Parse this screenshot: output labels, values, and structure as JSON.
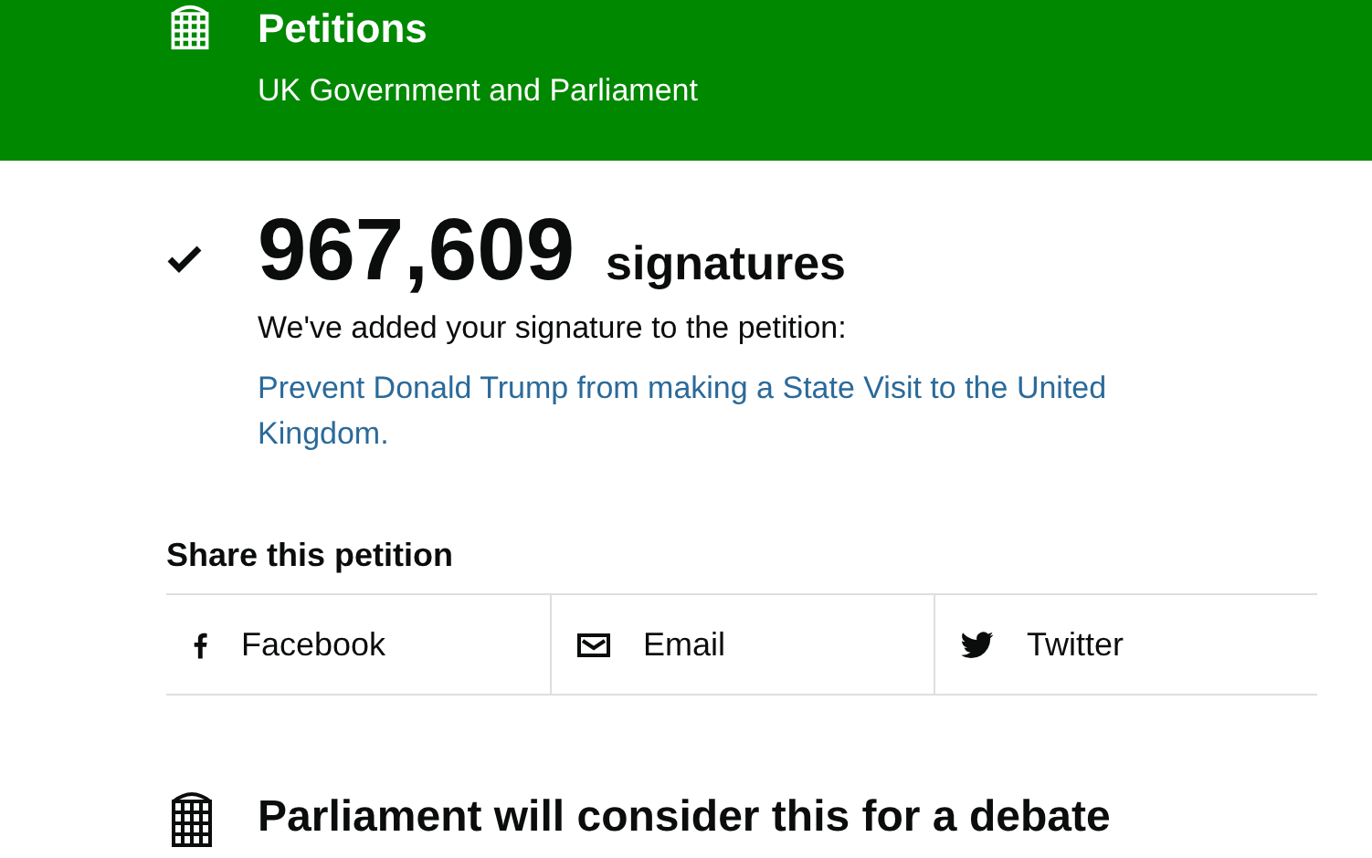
{
  "header": {
    "title": "Petitions",
    "subtitle": "UK Government and Parliament"
  },
  "signed": {
    "count": "967,609",
    "unit": "signatures",
    "message": "We've added your signature to the petition:",
    "petition_link": "Prevent Donald Trump from making a State Visit to the United Kingdom."
  },
  "share": {
    "heading": "Share this petition",
    "items": [
      {
        "kind": "facebook",
        "label": "Facebook"
      },
      {
        "kind": "email",
        "label": "Email"
      },
      {
        "kind": "twitter",
        "label": "Twitter"
      }
    ]
  },
  "debate": {
    "heading": "Parliament will consider this for a debate"
  }
}
